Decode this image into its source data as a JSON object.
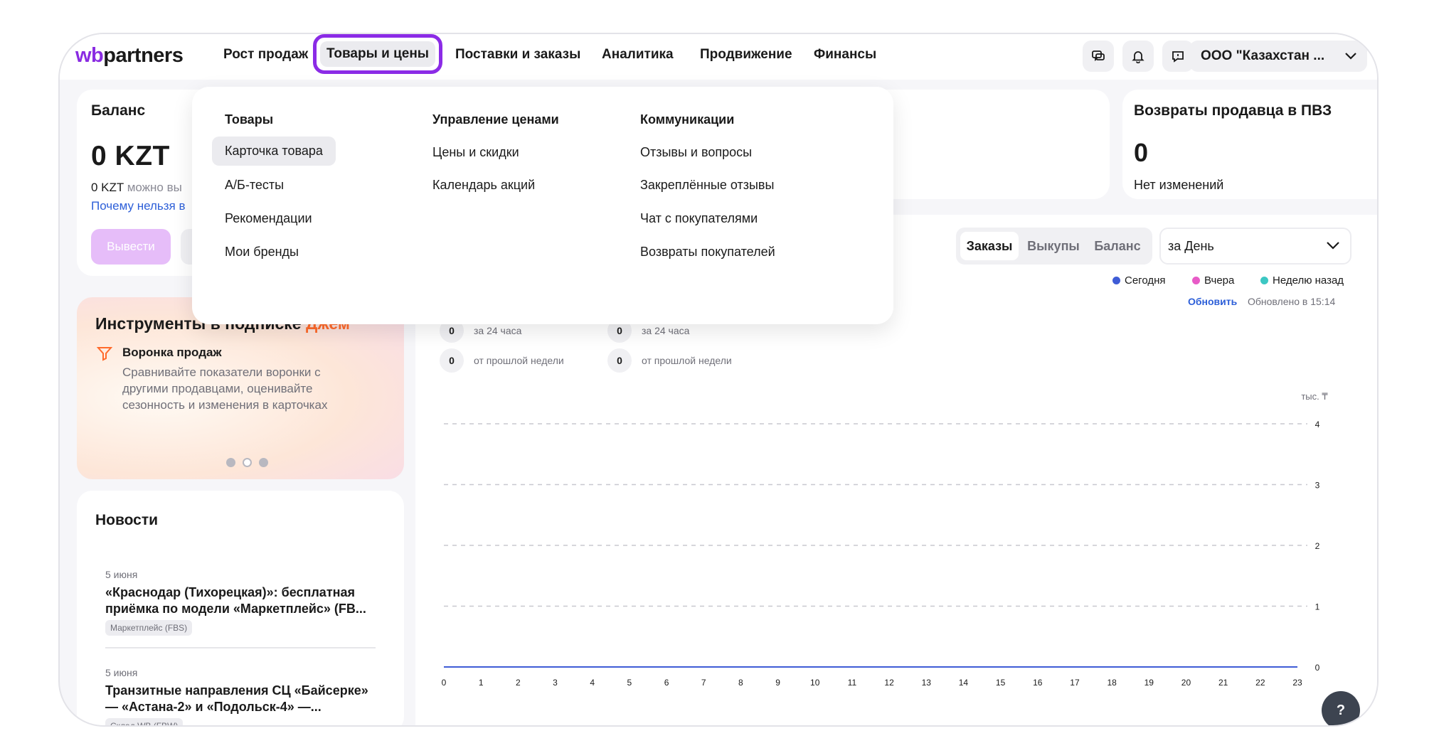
{
  "header": {
    "logo_wb": "wb",
    "logo_partners": "partners",
    "nav": [
      "Рост продаж",
      "Товары и цены",
      "Поставки и заказы",
      "Аналитика",
      "Продвижение",
      "Финансы"
    ],
    "org_name": "ООО \"Казахстан ..."
  },
  "icons": {
    "chat": "chat-icon",
    "bell": "bell-icon",
    "feedback": "feedback-icon",
    "chevron": "chevron-down-icon",
    "funnel": "funnel-icon"
  },
  "colors": {
    "accent": "#8b2be6",
    "jam_accent": "#ff6a2b",
    "link": "#2d5fd8",
    "today": "#3f5cd6",
    "yesterday": "#e85bc7",
    "week_ago": "#3cc7c3"
  },
  "balance": {
    "title": "Баланс",
    "value": "0 KZT",
    "sub_amount": "0 KZT",
    "sub_text": "можно вы",
    "why_link": "Почему нельзя в",
    "withdraw_label": "Вывести"
  },
  "jam": {
    "title": "Инструменты в подписке",
    "title_accent": "Джем",
    "feature_title": "Воронка продаж",
    "feature_desc": "Сравнивайте показатели воронки с другими продавцами, оценивайте сезонность и изменения в карточках"
  },
  "news": {
    "title": "Новости",
    "items": [
      {
        "date": "5 июня",
        "title": "«Краснодар (Тихорецкая)»: бесплатная приёмка по модели «Маркетплейс» (FB...",
        "tag": "Маркетплейс (FBS)"
      },
      {
        "date": "5 июня",
        "title": "Транзитные направления СЦ «Байсерке» — «Астана-2» и «Подольск-4» —...",
        "tag": "Склад WB (FBW)"
      }
    ]
  },
  "returns": {
    "title": "Возвраты продавца в ПВЗ",
    "value": "0",
    "sub": "Нет изменений"
  },
  "chart_controls": {
    "tabs": [
      "Заказы",
      "Выкупы",
      "Баланс"
    ],
    "active_tab": "Заказы",
    "period": "за День",
    "legend": [
      "Сегодня",
      "Вчера",
      "Неделю назад"
    ],
    "refresh_label": "Обновить",
    "updated_label": "Обновлено в 15:14"
  },
  "stats": [
    {
      "value": "0",
      "label": "за 24 часа"
    },
    {
      "value": "0",
      "label": "от прошлой недели"
    },
    {
      "value": "0",
      "label": "за 24 часа"
    },
    {
      "value": "0",
      "label": "от прошлой недели"
    }
  ],
  "chart_data": {
    "type": "line",
    "x": [
      0,
      1,
      2,
      3,
      4,
      5,
      6,
      7,
      8,
      9,
      10,
      11,
      12,
      13,
      14,
      15,
      16,
      17,
      18,
      19,
      20,
      21,
      22,
      23
    ],
    "ylim": [
      0,
      4
    ],
    "yticks": [
      0,
      1,
      2,
      3,
      4
    ],
    "ylabel": "тыс. ₸",
    "grid": true,
    "series": [
      {
        "name": "Сегодня",
        "values": [
          0,
          0,
          0,
          0,
          0,
          0,
          0,
          0,
          0,
          0,
          0,
          0,
          0,
          0,
          0,
          0,
          0,
          0,
          0,
          0,
          0,
          0,
          0,
          0
        ]
      }
    ]
  },
  "dropdown": {
    "columns": [
      {
        "heading": "Товары",
        "items": [
          "Карточка товара",
          "А/Б-тесты",
          "Рекомендации",
          "Мои бренды"
        ]
      },
      {
        "heading": "Управление ценами",
        "items": [
          "Цены и скидки",
          "Календарь акций"
        ]
      },
      {
        "heading": "Коммуникации",
        "items": [
          "Отзывы и вопросы",
          "Закреплённые отзывы",
          "Чат с покупателями",
          "Возвраты покупателей"
        ]
      }
    ],
    "highlighted": "Карточка товара"
  },
  "help_label": "?"
}
